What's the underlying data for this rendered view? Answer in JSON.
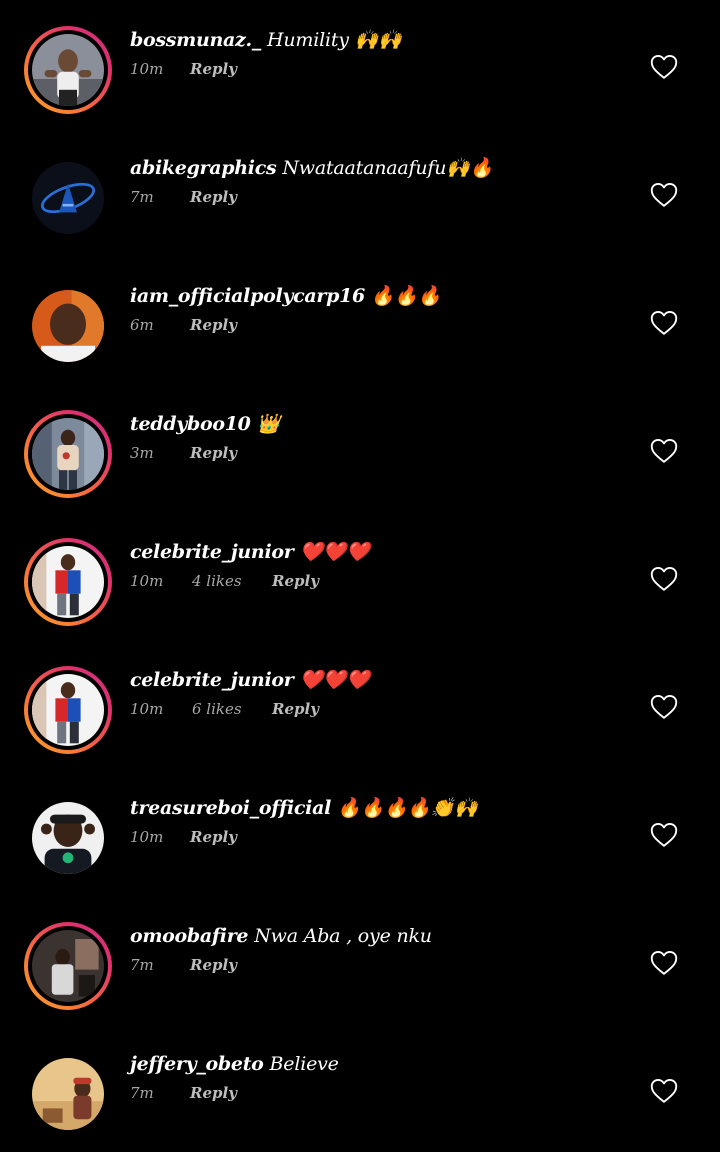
{
  "comments": [
    {
      "username": "bossmunaz._",
      "text": "Humility 🙌🙌",
      "time": "10m",
      "likes": "",
      "reply_label": "Reply",
      "story": true,
      "avatar": "man-gym-photo"
    },
    {
      "username": "abikegraphics",
      "text": "Nwataatanaafufu🙌🔥",
      "time": "7m",
      "likes": "",
      "reply_label": "Reply",
      "story": false,
      "avatar": "graphics-logo"
    },
    {
      "username": "iam_officialpolycarp16",
      "text": "🔥🔥🔥",
      "time": "6m",
      "likes": "",
      "reply_label": "Reply",
      "story": false,
      "avatar": "man-selfie-orange"
    },
    {
      "username": "teddyboo10",
      "text": "👑",
      "time": "3m",
      "likes": "",
      "reply_label": "Reply",
      "story": true,
      "avatar": "man-mall-photo"
    },
    {
      "username": "celebrite_junior",
      "text": "❤️❤️❤️",
      "time": "10m",
      "likes": "4 likes",
      "reply_label": "Reply",
      "story": true,
      "avatar": "man-red-blue-shirt"
    },
    {
      "username": "celebrite_junior",
      "text": "❤️❤️❤️",
      "time": "10m",
      "likes": "6 likes",
      "reply_label": "Reply",
      "story": true,
      "avatar": "man-red-blue-shirt"
    },
    {
      "username": "treasureboi_official",
      "text": "🔥🔥🔥🔥👏🙌",
      "time": "10m",
      "likes": "",
      "reply_label": "Reply",
      "story": false,
      "avatar": "man-green-chain"
    },
    {
      "username": "omoobafire",
      "text": "Nwa Aba , oye nku",
      "time": "7m",
      "likes": "",
      "reply_label": "Reply",
      "story": true,
      "avatar": "man-dark-room"
    },
    {
      "username": "jeffery_obeto",
      "text": "Believe",
      "time": "7m",
      "likes": "",
      "reply_label": "Reply",
      "story": false,
      "avatar": "man-red-cap"
    }
  ],
  "icons": {
    "like": "heart-outline-icon"
  },
  "colors": {
    "background": "#000000",
    "meta_text": "#a8a8a8",
    "story_ring_start": "#f9a825",
    "story_ring_end": "#c13584"
  }
}
